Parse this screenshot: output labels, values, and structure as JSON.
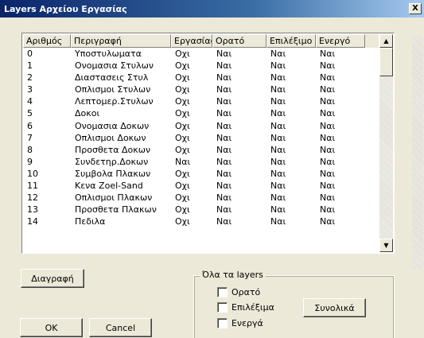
{
  "window": {
    "title": "Layers Αρχείου Εργασίας",
    "close_label": "X"
  },
  "table": {
    "columns": [
      "Αριθμός",
      "Περιγραφή",
      "Εργασίας",
      "Ορατό",
      "Επιλέξιμο",
      "Ενεργό"
    ],
    "rows": [
      [
        "0",
        "Υποστυλωματα",
        "Οχι",
        "Ναι",
        "Ναι",
        "Ναι"
      ],
      [
        "1",
        "Ονομασια Στυλων",
        "Οχι",
        "Ναι",
        "Ναι",
        "Ναι"
      ],
      [
        "2",
        "Διαστασεις Στυλ",
        "Οχι",
        "Ναι",
        "Ναι",
        "Ναι"
      ],
      [
        "3",
        "Οπλισμοι Στυλων",
        "Οχι",
        "Ναι",
        "Ναι",
        "Ναι"
      ],
      [
        "4",
        "Λεπτομερ.Στυλων",
        "Οχι",
        "Ναι",
        "Ναι",
        "Ναι"
      ],
      [
        "5",
        "Δοκοι",
        "Οχι",
        "Ναι",
        "Ναι",
        "Ναι"
      ],
      [
        "6",
        "Ονομασια Δοκων",
        "Οχι",
        "Ναι",
        "Ναι",
        "Ναι"
      ],
      [
        "7",
        "Οπλισμοι Δοκων",
        "Οχι",
        "Ναι",
        "Ναι",
        "Ναι"
      ],
      [
        "8",
        "Προσθετα Δοκων",
        "Οχι",
        "Ναι",
        "Ναι",
        "Ναι"
      ],
      [
        "9",
        "Συνδετηρ.Δοκων",
        "Ναι",
        "Ναι",
        "Ναι",
        "Ναι"
      ],
      [
        "10",
        "Συμβολα Πλακων",
        "Οχι",
        "Ναι",
        "Ναι",
        "Ναι"
      ],
      [
        "11",
        "Κενα Zoel-Sand",
        "Οχι",
        "Ναι",
        "Ναι",
        "Ναι"
      ],
      [
        "12",
        "Οπλισμοι Πλακων",
        "Οχι",
        "Ναι",
        "Ναι",
        "Ναι"
      ],
      [
        "13",
        "Προσθετα Πλακων",
        "Οχι",
        "Ναι",
        "Ναι",
        "Ναι"
      ],
      [
        "14",
        "Πεδιλα",
        "Οχι",
        "Ναι",
        "Ναι",
        "Ναι"
      ]
    ]
  },
  "buttons": {
    "delete": "Διαγραφή",
    "ok": "OK",
    "cancel": "Cancel",
    "total": "Συνολικά"
  },
  "group": {
    "legend": "Όλα τα layers",
    "visible": "Ορατό",
    "selectable": "Επιλέξιμα",
    "active": "Ενεργά"
  }
}
